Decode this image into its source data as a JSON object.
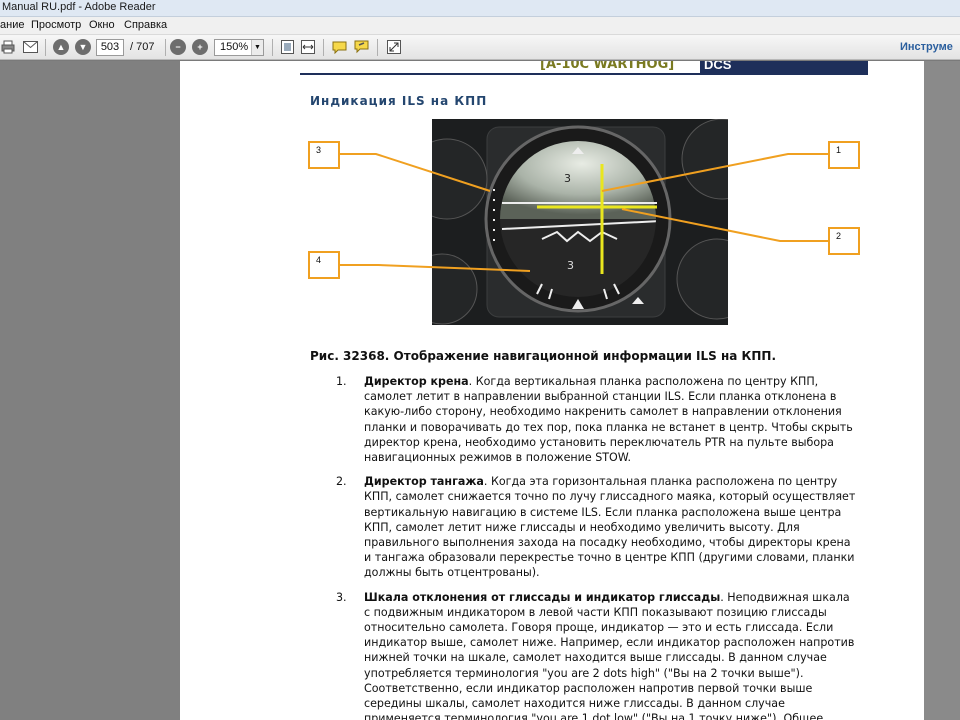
{
  "window": {
    "title": "Manual RU.pdf - Adobe Reader"
  },
  "menu": {
    "items": [
      "ание",
      "Просмотр",
      "Окно",
      "Справка"
    ]
  },
  "toolbar": {
    "current_page": "503",
    "total_pages": "/ 707",
    "zoom": "150%",
    "tools_label": "Инструме"
  },
  "page": {
    "banner_left": "[A-10C WARTHOG]",
    "banner_right": "DCS",
    "section_title": "Индикация ILS на КПП",
    "callouts": [
      "3",
      "1",
      "2",
      "4"
    ],
    "caption": "Рис. 32368. Отображение навигационной информации ILS на КПП.",
    "items": [
      {
        "num": "1.",
        "bold": "Директор крена",
        "text": ". Когда вертикальная планка расположена по центру КПП, самолет летит в направлении выбранной станции ILS. Если планка отклонена в какую-либо сторону, необходимо накренить самолет в направлении отклонения планки и поворачивать до тех пор, пока планка не встанет в центр. Чтобы скрыть директор крена, необходимо установить переключатель PTR на пульте выбора навигационных режимов в положение STOW."
      },
      {
        "num": "2.",
        "bold": "Директор тангажа",
        "text": ". Когда эта горизонтальная планка расположена по центру КПП, самолет снижается точно по лучу глиссадного маяка, который осуществляет вертикальную навигацию в системе ILS. Если планка расположена выше центра КПП, самолет летит ниже глиссады и необходимо увеличить высоту. Для правильного выполнения захода на посадку необходимо, чтобы директоры крена и тангажа образовали перекрестье точно в центре КПП (другими словами, планки должны быть отцентрованы)."
      },
      {
        "num": "3.",
        "bold": "Шкала отклонения от глиссады и индикатор глиссады",
        "text": ". Неподвижная шкала с подвижным индикатором в левой части КПП показывают позицию глиссады относительно самолета. Говоря проще, индикатор — это и есть глиссада. Если индикатор выше, самолет ниже. Например, если индикатор расположен напротив нижней точки на шкале, самолет находится выше глиссады. В данном случае употребляется терминология \"you are 2 dots high\" (\"Вы на 2 точки выше\"). Соответственно, если индикатор расположен напротив первой точки выше середины шкалы, самолет находится ниже глиссады. В данном случае применяется терминология \"you are 1 dot low\" (\"Вы на 1 точку ниже\"). Общее правило гласит, что"
      }
    ]
  },
  "colors": {
    "callout": "#f0a020",
    "banner": "#1e2f5a",
    "title": "#24466f"
  }
}
